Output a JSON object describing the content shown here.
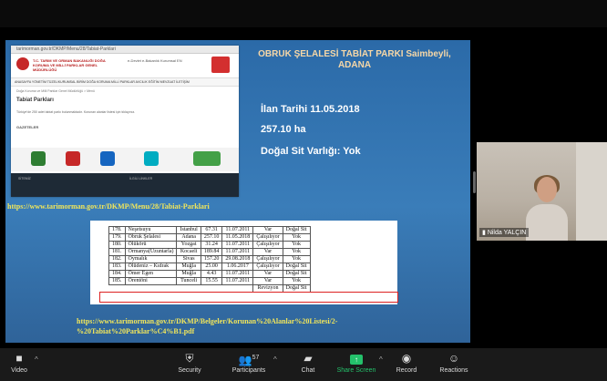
{
  "webpage": {
    "address": "tarimorman.gov.tr/DKMP/Menu/28/Tabiat-Parklari",
    "org_name": "T.C. TARIM VE ORMAN BAKANLIĞI DOĞA KORUMA VE MİLLİ PARKLAR GENEL MÜDÜRLÜĞÜ",
    "header_links": "e-Devlet  e-Bakanlık  Kurumsal  EN",
    "nav": "ANASAYFA  YÖNETİM  TÜZEL/KURUMSAL  BİRİM  DOĞA KORUMA  MİLLİ PARKLAR  AVCILIK  EĞİTİM  MEVZUAT  İLETİŞİM",
    "breadcrumb": "Doğa Koruma ve Milli Parklar Genel Müdürlüğü > Menü",
    "page_title": "Tabiat Parkları",
    "page_text": "Türkiye'de 250 adet tabiat parkı bulunmaktadır. Korunan alanlar listesi için tıklayınız.",
    "gazette": "GAZETELER",
    "footer_left": "SİTEMİZ",
    "footer_right": "İLGİLİ LİNKLER"
  },
  "slide": {
    "title": "OBRUK ŞELALESİ TABİAT PARKI Saimbeyli, ADANA",
    "ilan": "İlan Tarihi 11.05.2018",
    "area": "257.10 ha",
    "sit": "Doğal Sit Varlığı: Yok",
    "url1": "https://www.tarimorman.gov.tr/DKMP/Menu/28/Tabiat-Parklari",
    "url2_line1": "https://www.tarimorman.gov.tr/DKMP/Belgeler/Korunan%20Alanlar%20Listesi/2-",
    "url2_line2": "%20Tabiat%20Parklar%C4%B1.pdf"
  },
  "table_rows": [
    [
      "178.",
      "Neşetsuyu",
      "İstanbul",
      "67.31",
      "11.07.2011",
      "Var",
      "Doğal Sit"
    ],
    [
      "179.",
      "Obruk Şelalesi",
      "Adana",
      "257.10",
      "11.05.2018",
      "Çalışılıyor",
      "Yok"
    ],
    [
      "180.",
      "Ölükörü",
      "Yozgat",
      "31.24",
      "11.07.2011",
      "Çalışılıyor",
      "Yok"
    ],
    [
      "181.",
      "Ormanya(Uzuntarla)",
      "Kocaeli",
      "189.84",
      "11.07.2011",
      "Var",
      "Yok"
    ],
    [
      "182.",
      "Oymalık",
      "Sivas",
      "157.20",
      "29.08.2018",
      "Çalışılıyor",
      "Yok"
    ],
    [
      "183.",
      "Ölüdeniz – Kıdrak",
      "Muğla",
      "25.00",
      "1.06.2017",
      "Çalışılıyor",
      "Doğal Sit"
    ],
    [
      "184.",
      "Ömer Egen",
      "Muğla",
      "4.43",
      "11.07.2011",
      "Var",
      "Doğal Sit"
    ],
    [
      "185.",
      "Örentöni",
      "Tunceli",
      "15.55",
      "11.07.2011",
      "Var",
      "Yok"
    ],
    [
      "",
      "",
      "",
      "",
      "",
      "Revizyon",
      "Doğal Sit"
    ]
  ],
  "participant": {
    "name": "Nilda YALÇIN"
  },
  "toolbar": {
    "video": "Video",
    "security": "Security",
    "participants": "Participants",
    "participants_count": "57",
    "chat": "Chat",
    "share_screen": "Share Screen",
    "record": "Record",
    "reactions": "Reactions"
  },
  "icons": {
    "video": "camera-icon",
    "security": "shield-icon",
    "participants": "people-icon",
    "chat": "speech-bubble-icon",
    "share": "share-arrow-icon",
    "record": "record-circle-icon",
    "reactions": "smiley-icon"
  },
  "colors": {
    "share_accent": "#24c16b",
    "highlight": "#dd2222",
    "url_yellow": "#f2e65a"
  }
}
